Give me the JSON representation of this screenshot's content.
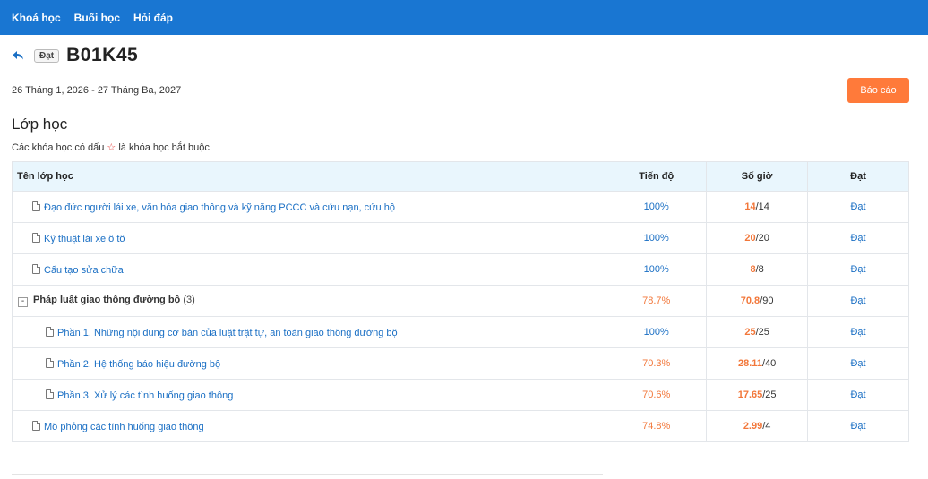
{
  "nav": {
    "items": [
      "Khoá học",
      "Buổi học",
      "Hỏi đáp"
    ]
  },
  "header": {
    "status_badge": "Đạt",
    "title": "B01K45"
  },
  "date_range": "26 Tháng 1, 2026 - 27 Tháng Ba, 2027",
  "report_button": "Báo cáo",
  "section": {
    "title": "Lớp học",
    "note_before": "Các khóa học có dấu",
    "note_star": "☆",
    "note_after": "là khóa học bắt buộc"
  },
  "table": {
    "headers": {
      "name": "Tên lớp học",
      "progress": "Tiến độ",
      "hours": "Số giờ",
      "pass": "Đạt"
    },
    "rows": [
      {
        "name": "Đạo đức người lái xe, văn hóa giao thông và kỹ năng PCCC và cứu nạn, cứu hộ",
        "progress": "100%",
        "hours_done": "14",
        "hours_total": "/14",
        "pass": "Đạt"
      },
      {
        "name": "Kỹ thuật lái xe ô tô",
        "progress": "100%",
        "hours_done": "20",
        "hours_total": "/20",
        "pass": "Đạt"
      },
      {
        "name": "Cấu tạo sửa chữa",
        "progress": "100%",
        "hours_done": "8",
        "hours_total": "/8",
        "pass": "Đạt"
      },
      {
        "name": "Pháp luật giao thông đường bộ",
        "count": "(3)",
        "toggle": "-",
        "progress": "78.7%",
        "hours_done": "70.8",
        "hours_total": "/90",
        "pass": "Đạt"
      },
      {
        "name": "Phần 1. Những nội dung cơ bản của luật trật tự, an toàn giao thông đường bộ",
        "progress": "100%",
        "hours_done": "25",
        "hours_total": "/25",
        "pass": "Đạt"
      },
      {
        "name": "Phần 2. Hệ thống báo hiệu đường bộ",
        "progress": "70.3%",
        "hours_done": "28.11",
        "hours_total": "/40",
        "pass": "Đạt"
      },
      {
        "name": "Phần 3. Xử lý các tình huống giao thông",
        "progress": "70.6%",
        "hours_done": "17.65",
        "hours_total": "/25",
        "pass": "Đạt"
      },
      {
        "name": "Mô phỏng các tình huống giao thông",
        "progress": "74.8%",
        "hours_done": "2.99",
        "hours_total": "/4",
        "pass": "Đạt"
      }
    ]
  },
  "colors": {
    "nav_bg": "#1976d2",
    "link": "#1a6fc4",
    "accent_orange": "#f2773a",
    "report_button": "#ff7a3a",
    "header_bg": "#e9f6fd"
  }
}
